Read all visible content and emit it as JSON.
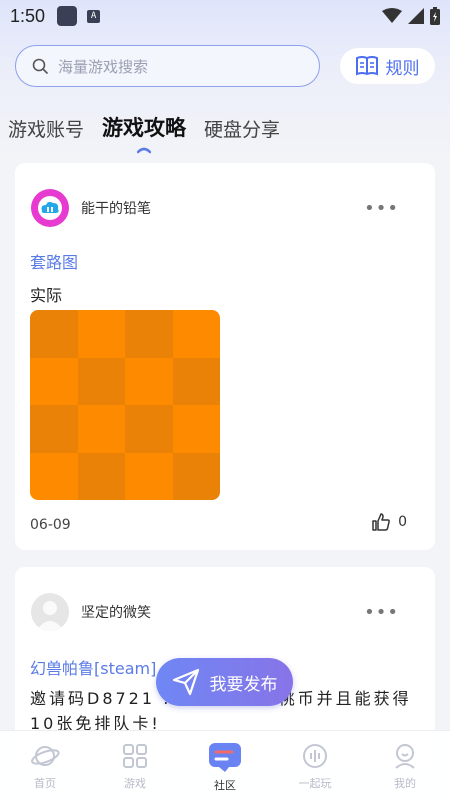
{
  "status_bar": {
    "time": "1:50",
    "notification_icon": "A"
  },
  "search": {
    "placeholder": "海量游戏搜索"
  },
  "rules_button": {
    "label": "规则"
  },
  "tabs": [
    {
      "label": "游戏账号",
      "active": false
    },
    {
      "label": "游戏攻略",
      "active": true
    },
    {
      "label": "硬盘分享",
      "active": false
    }
  ],
  "posts": [
    {
      "username": "能干的铅笔",
      "title": "套路图",
      "body": "实际",
      "date": "06-09",
      "likes": "0"
    },
    {
      "username": "坚定的微笑",
      "title": "幻兽帕鲁[steam]",
      "body": "邀请码D8721 …直接得300桃币并且能获得10张免排队卡!"
    }
  ],
  "publish_button": {
    "label": "我要发布"
  },
  "bottom_nav": [
    {
      "label": "首页",
      "icon": "planet-icon",
      "active": false
    },
    {
      "label": "游戏",
      "icon": "grid-icon",
      "active": false
    },
    {
      "label": "社区",
      "icon": "chat-icon",
      "active": true
    },
    {
      "label": "一起玩",
      "icon": "voice-icon",
      "active": false
    },
    {
      "label": "我的",
      "icon": "profile-icon",
      "active": false
    }
  ],
  "colors": {
    "accent": "#4c6ef0",
    "link": "#5a7be6",
    "image_dark": "#e98206",
    "image_light": "#fe8a00"
  }
}
